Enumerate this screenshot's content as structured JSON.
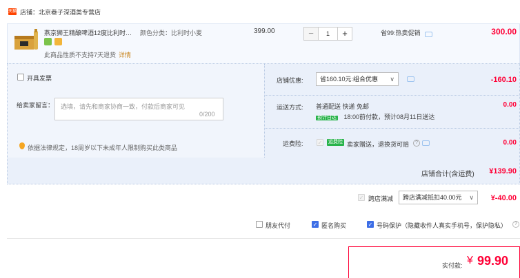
{
  "store": {
    "icon_text": "天猫",
    "label": "店铺：北京巷子深酒类专营店"
  },
  "item": {
    "title": "燕京狮王精酿啤酒12度比利时…",
    "spec": "颜色分类：比利时小麦",
    "unit_price": "399.00",
    "quantity": "1",
    "minus": "−",
    "plus": "+",
    "save_note": "省99:热卖促销",
    "total": "300.00",
    "return_note": "此商品性质不支持7天退货",
    "return_link": "详情"
  },
  "options": {
    "invoice_label": "开具发票",
    "memo_label": "给卖家留言：",
    "memo_placeholder": "选填，请先和商家协商一致，付款后商家可见",
    "memo_count": "0/200",
    "warning": "依据法律规定，18周岁以下未成年人限制购买此类商品"
  },
  "store_discount": {
    "label": "店铺优惠:",
    "selected": "省160.10元:组合优惠",
    "value": "-160.10"
  },
  "shipping": {
    "label": "运送方式:",
    "method": "普通配送 快递 免邮",
    "tag": "预计日达",
    "eta": "18:00前付款，预计08月11日送达",
    "value": "0.00"
  },
  "freight_insurance": {
    "label": "运费险:",
    "tag": "运费险",
    "desc": "卖家赠送，退换货可赔",
    "value": "0.00"
  },
  "store_total": {
    "label": "店铺合计(含运费)",
    "value": "¥139.90"
  },
  "cross_store": {
    "label": "跨店满减",
    "selected": "跨店满减抵扣40.00元",
    "value": "¥-40.00"
  },
  "privacy": {
    "friend_pay": "朋友代付",
    "anonymous": "匿名购买",
    "number_protect": "号码保护（隐藏收件人真实手机号，保护隐私）"
  },
  "payment": {
    "label": "实付款:",
    "currency": "¥",
    "amount": "99.90"
  },
  "colors": {
    "accent": "#ff0036",
    "brand": "#ff4400",
    "panel": "#f1f5fc",
    "check": "#3d6ee6"
  }
}
